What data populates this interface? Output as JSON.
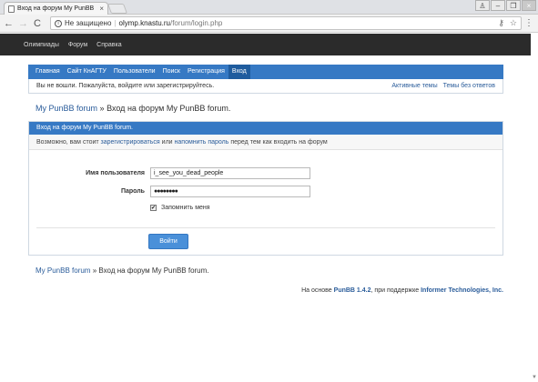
{
  "browser": {
    "tab_title": "Вход на форум My PunBB",
    "tab_close": "×",
    "security_label": "Не защищено",
    "url_host": "olymp.knastu.ru",
    "url_path": "/forum/login.php",
    "back": "←",
    "forward": "→",
    "reload": "C",
    "key": "⚷",
    "star": "☆",
    "menu": "⋮",
    "win_user": "♙",
    "win_min": "–",
    "win_max": "❐",
    "win_close": "×"
  },
  "site_nav": [
    "Олимпиады",
    "Форум",
    "Справка"
  ],
  "forum_nav": {
    "items": [
      "Главная",
      "Сайт КнАГТУ",
      "Пользователи",
      "Поиск",
      "Регистрация",
      "Вход"
    ],
    "active": "Вход"
  },
  "status": {
    "text": "Вы не вошли. Пожалуйста, войдите или зарегистрируйтесь.",
    "links": [
      "Активные темы",
      "Темы без ответов"
    ]
  },
  "breadcrumb": {
    "home": "My PunBB forum",
    "sep": "»",
    "current": "Вход на форум My PunBB forum."
  },
  "panel": {
    "header": "Вход на форум My PunBB forum.",
    "intro_before": "Возможно, вам стоит",
    "intro_link1": "зарегистрироваться",
    "intro_mid": "или",
    "intro_link2": "напомнить пароль",
    "intro_after": "перед тем как входить на форум"
  },
  "form": {
    "username_label": "Имя пользователя",
    "username_value": "i_see_you_dead_people",
    "password_label": "Пароль",
    "password_value": "●●●●●●●●",
    "remember_label": "Запомнить меня",
    "remember_mark": "✔",
    "submit_label": "Войти"
  },
  "footer": {
    "prefix": "На основе",
    "engine": "PunBB 1.4.2",
    "mid": ", при поддержке",
    "sponsor": "Informer Technologies, Inc."
  }
}
